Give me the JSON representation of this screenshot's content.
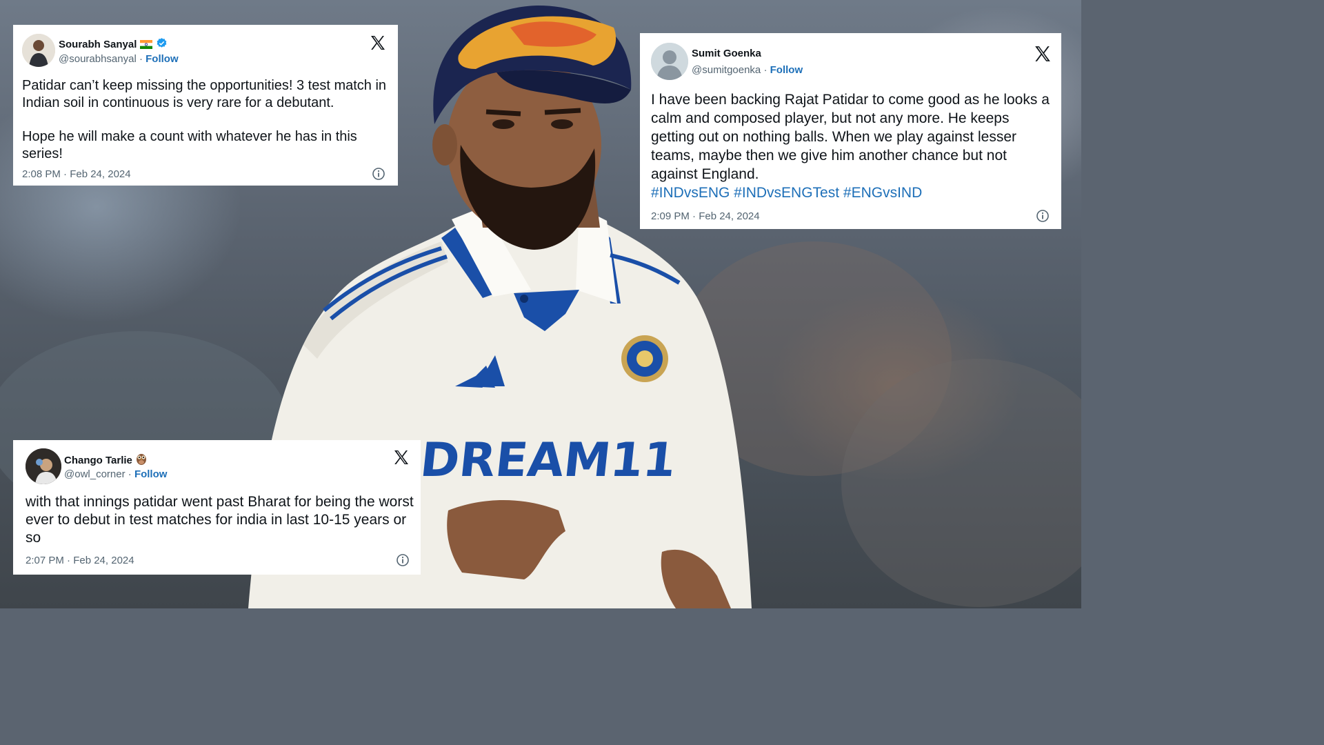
{
  "tweets": [
    {
      "name": "Sourabh Sanyal",
      "name_emoji": "flag-india-icon",
      "verified": true,
      "handle": "@sourabhsanyal",
      "separator": "·",
      "follow": "Follow",
      "text_lines": [
        "Patidar can’t keep missing the opportunities! 3 test match in Indian soil in continuous is very rare for a debutant.",
        "Hope he will make a count with whatever he has in this series!"
      ],
      "timestamp": "2:08 PM · Feb 24, 2024"
    },
    {
      "name": "Sumit Goenka",
      "handle": "@sumitgoenka",
      "separator": "·",
      "follow": "Follow",
      "text": "I have been backing Rajat Patidar to come good as he looks a calm and composed player, but not any more. He keeps getting out on nothing balls. When we play against lesser teams, maybe then we give him another chance but not against England.",
      "hashtags": "#INDvsENG #INDvsENGTest #ENGvsIND",
      "timestamp": "2:09 PM · Feb 24, 2024"
    },
    {
      "name": "Chango Tarlie",
      "name_emoji": "owl-icon",
      "handle": "@owl_corner",
      "separator": "·",
      "follow": "Follow",
      "text": "with that innings patidar went past Bharat for being the worst ever to debut in test matches for india in last 10-15 years or so",
      "timestamp": "2:07 PM · Feb 24, 2024"
    }
  ],
  "photo": {
    "jersey_sponsor": "DREAM11"
  },
  "colors": {
    "link": "#1d6fb8",
    "muted": "#536471",
    "text": "#0f1419",
    "verified": "#1d9bf0",
    "jersey_blue": "#1a4fa8",
    "cap_navy": "#1b2550"
  }
}
